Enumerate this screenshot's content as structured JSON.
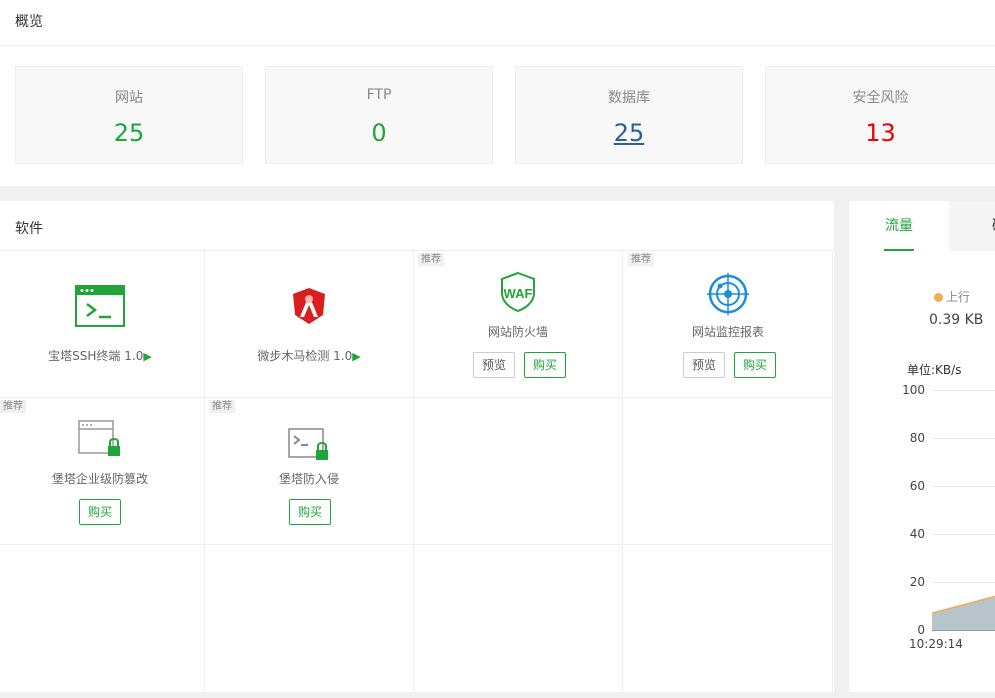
{
  "overview": {
    "title": "概览",
    "stats": [
      {
        "label": "网站",
        "value": "25"
      },
      {
        "label": "FTP",
        "value": "0"
      },
      {
        "label": "数据库",
        "value": "25"
      },
      {
        "label": "安全风险",
        "value": "13"
      }
    ]
  },
  "software": {
    "title": "软件",
    "tag": "推荐",
    "items": [
      {
        "name": "宝塔SSH终端 1.0"
      },
      {
        "name": "微步木马检测 1.0"
      },
      {
        "name": "网站防火墙",
        "icon_text": "WAF",
        "preview": "预览",
        "buy": "购买"
      },
      {
        "name": "网站监控报表",
        "preview": "预览",
        "buy": "购买"
      },
      {
        "name": "堡塔企业级防篡改",
        "buy": "购买"
      },
      {
        "name": "堡塔防入侵",
        "buy": "购买"
      }
    ]
  },
  "traffic": {
    "tabs": [
      "流量",
      "磁"
    ],
    "upstream_label": "上行",
    "upstream_value": "0.39 KB",
    "unit_label": "单位:KB/s",
    "colors": {
      "upstream": "#f0ad4e",
      "accent": "#20a53a"
    },
    "chart_data": {
      "type": "area",
      "x": [
        "10:29:14"
      ],
      "yticks": [
        100,
        80,
        60,
        40,
        20,
        0
      ],
      "ylim": [
        0,
        100
      ],
      "ylabel": "单位:KB/s",
      "series": [
        {
          "name": "上行",
          "values": [
            7,
            14
          ]
        }
      ]
    }
  }
}
